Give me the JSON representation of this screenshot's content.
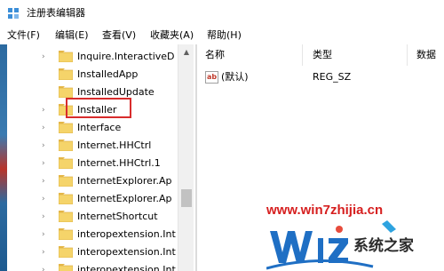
{
  "window": {
    "title": "注册表编辑器"
  },
  "menu": [
    "文件(F)",
    "编辑(E)",
    "查看(V)",
    "收藏夹(A)",
    "帮助(H)"
  ],
  "tree": {
    "items": [
      {
        "label": "Inquire.InteractiveD",
        "expandable": true
      },
      {
        "label": "InstalledApp",
        "expandable": false
      },
      {
        "label": "InstalledUpdate",
        "expandable": false
      },
      {
        "label": "Installer",
        "expandable": true,
        "highlighted": true
      },
      {
        "label": "Interface",
        "expandable": true
      },
      {
        "label": "Internet.HHCtrl",
        "expandable": true
      },
      {
        "label": "Internet.HHCtrl.1",
        "expandable": true
      },
      {
        "label": "InternetExplorer.Ap",
        "expandable": true
      },
      {
        "label": "InternetExplorer.Ap",
        "expandable": true
      },
      {
        "label": "InternetShortcut",
        "expandable": true
      },
      {
        "label": "interopextension.Int",
        "expandable": true
      },
      {
        "label": "interopextension.Int",
        "expandable": true
      },
      {
        "label": "interopextension.Int",
        "expandable": true
      }
    ]
  },
  "list": {
    "columns": [
      "名称",
      "类型",
      "数据"
    ],
    "rows": [
      {
        "icon": "ab",
        "name": "(默认)",
        "type": "REG_SZ"
      }
    ]
  },
  "watermark": {
    "url": "www.win7zhijia.cn",
    "brand": "系统之家"
  },
  "colors": {
    "highlight_border": "#d82c2c",
    "folder": "#f5d46a",
    "watermark_red": "#d61f1f"
  }
}
